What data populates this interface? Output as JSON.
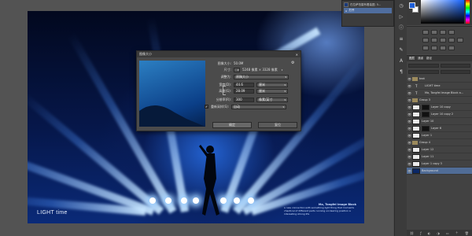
{
  "document": {
    "caption": "LIGHT time",
    "credit_title": "Ma, Tongfei Image Block",
    "credit_body": "a new connection with something light thing that moments chaotical of different parts running unclearing position a interesting strong life"
  },
  "dialog": {
    "title": "图像大小",
    "image_size_label": "图像大小:",
    "image_size_value": "50.0M",
    "dimensions_label": "尺寸:",
    "dimensions_value": "5248 像素 × 3328 像素",
    "fit_to_label": "调整为:",
    "fit_to_value": "原稿大小",
    "width_label": "宽度(D):",
    "width_value": "44.6",
    "width_unit": "厘米",
    "height_label": "高度(G):",
    "height_value": "28.09",
    "height_unit": "厘米",
    "resolution_label": "分辨率(R):",
    "resolution_value": "300",
    "resolution_unit": "像素/英寸",
    "resample_label": "重新采样(S):",
    "resample_value": "自动",
    "ok_label": "确定",
    "cancel_label": "复位"
  },
  "history": {
    "row1": "在拉萨拍摄有着装图. 5...",
    "row2": "打开"
  },
  "layers": {
    "tabs": [
      "图层",
      "通道",
      "路径"
    ],
    "items": [
      {
        "name": "text",
        "type": "group"
      },
      {
        "name": "LIGHT time",
        "type": "text"
      },
      {
        "name": "Ma, Tongfei Image Block a...",
        "type": "text"
      },
      {
        "name": "Group 3",
        "type": "group"
      },
      {
        "name": "Layer 10 copy",
        "type": "mask"
      },
      {
        "name": "Layer 10 copy 2",
        "type": "mask"
      },
      {
        "name": "Layer 10",
        "type": "layer"
      },
      {
        "name": "Layer 6",
        "type": "mask"
      },
      {
        "name": "Layer 1",
        "type": "layer"
      },
      {
        "name": "Group 4",
        "type": "group"
      },
      {
        "name": "Layer 12",
        "type": "layer"
      },
      {
        "name": "Layer 11",
        "type": "layer"
      },
      {
        "name": "Layer 1 copy 3",
        "type": "layer"
      },
      {
        "name": "Background",
        "type": "background"
      }
    ]
  }
}
